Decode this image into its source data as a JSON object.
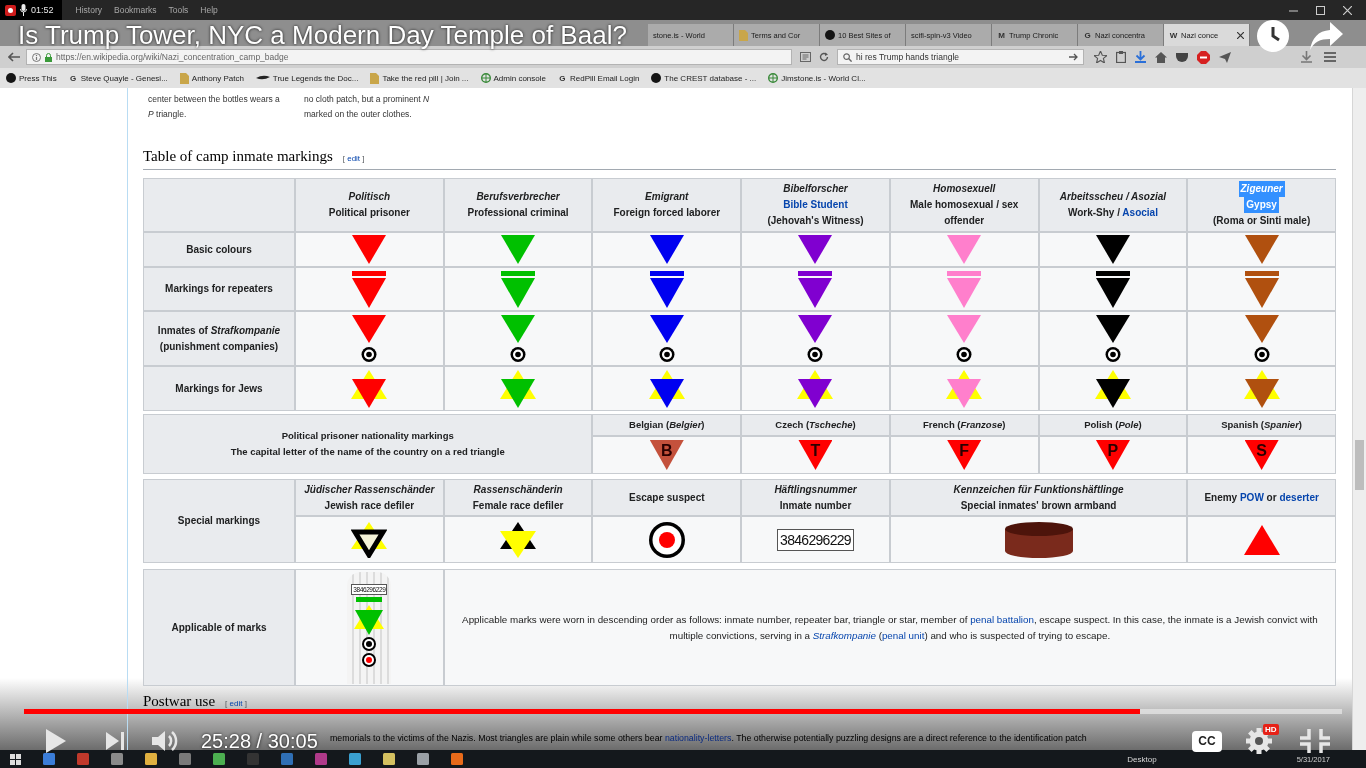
{
  "video": {
    "title": "Is Trump Tower, NYC a Modern Day Temple of Baal?"
  },
  "recorder": {
    "timer": "01:52"
  },
  "browser": {
    "menu": [
      "History",
      "Bookmarks",
      "Tools",
      "Help"
    ],
    "tabs": [
      {
        "title": "stone.is - World",
        "kind": "none",
        "selected": false
      },
      {
        "title": "Terms and Cor",
        "kind": "page",
        "selected": false
      },
      {
        "title": "10 Best Sites of",
        "kind": "disc",
        "selected": false
      },
      {
        "title": "scifi-spin-v3 Video",
        "kind": "none",
        "selected": false
      },
      {
        "title": "Trump Chronic",
        "kind": "letter",
        "favicon": "M",
        "selected": false
      },
      {
        "title": "Nazi concentra",
        "kind": "letter",
        "favicon": "G",
        "selected": false
      },
      {
        "title": "Nazi conce",
        "kind": "letter",
        "favicon": "W",
        "selected": true
      }
    ],
    "url": "https://en.wikipedia.org/wiki/Nazi_concentration_camp_badge",
    "search": {
      "value": "hi res Trump hands triangle"
    },
    "bookmarks": [
      {
        "label": "Press This",
        "kind": "disc"
      },
      {
        "label": "Steve Quayle - Genesi...",
        "kind": "letter",
        "favicon": "G"
      },
      {
        "label": "Anthony Patch",
        "kind": "page"
      },
      {
        "label": "True Legends the Doc...",
        "kind": "swoosh"
      },
      {
        "label": "Take the red pill | Join ...",
        "kind": "page"
      },
      {
        "label": "Admin console",
        "kind": "globe"
      },
      {
        "label": "RedPill Email Login",
        "kind": "letter",
        "favicon": "G"
      },
      {
        "label": "The CREST database - ...",
        "kind": "disc"
      },
      {
        "label": "Jimstone.is - World Cl...",
        "kind": "globe"
      }
    ]
  },
  "article": {
    "snippets": [
      {
        "lines": [
          "center between the bottles wears a",
          "*P* triangle."
        ]
      },
      {
        "lines": [
          "no cloth patch, but a prominent *N*",
          "marked on the outer clothes."
        ]
      }
    ],
    "heading": {
      "title": "Table of camp inmate markings",
      "edit": [
        {
          "kind": "plain",
          "text": "[ "
        },
        {
          "kind": "link",
          "text": "edit"
        },
        {
          "kind": "plain",
          "text": " ]"
        }
      ]
    },
    "table": {
      "categories": [
        {
          "color": "#ff0000",
          "lines": [
            {
              "kind": "german",
              "text": "Politisch",
              "selected": false
            },
            {
              "kind": "english",
              "text": "Political prisoner",
              "selected": false
            }
          ]
        },
        {
          "color": "#00c000",
          "lines": [
            {
              "kind": "german",
              "text": "Berufsverbrecher",
              "selected": false
            },
            {
              "kind": "english",
              "text": "Professional criminal",
              "selected": false
            }
          ]
        },
        {
          "color": "#0000f0",
          "lines": [
            {
              "kind": "german",
              "text": "Emigrant",
              "selected": false
            },
            {
              "kind": "english",
              "text": "Foreign forced laborer",
              "selected": false
            }
          ]
        },
        {
          "color": "#8000d0",
          "lines": [
            {
              "kind": "german",
              "text": "Bibelforscher",
              "selected": false
            },
            {
              "kind": "english",
              "parts": [
                {
                  "kind": "link",
                  "text": "Bible Student"
                }
              ],
              "selected": false
            },
            {
              "kind": "english",
              "text": "(Jehovah's Witness)",
              "selected": false
            }
          ]
        },
        {
          "color": "#ff7fcc",
          "lines": [
            {
              "kind": "german",
              "text": "Homosexuell",
              "selected": false
            },
            {
              "kind": "english",
              "text": "Male homosexual / sex offender",
              "selected": false
            }
          ]
        },
        {
          "color": "#000000",
          "lines": [
            {
              "kind": "german",
              "text": "Arbeitsscheu / Asozial",
              "selected": false
            },
            {
              "kind": "english",
              "parts": [
                {
                  "kind": "plain",
                  "text": "Work-Shy / "
                },
                {
                  "kind": "link",
                  "text": "Asocial"
                }
              ],
              "selected": false
            }
          ]
        },
        {
          "color": "#b0500f",
          "lines": [
            {
              "kind": "german",
              "text": "Zigeuner",
              "selected": true
            },
            {
              "kind": "english",
              "text": "Gypsy",
              "selected": true
            },
            {
              "kind": "english",
              "text": "(Roma or Sinti male)",
              "selected": false
            }
          ]
        }
      ],
      "rows": [
        {
          "label": "Basic colours",
          "kind": "basic"
        },
        {
          "label": "Markings for repeaters",
          "kind": "repeater"
        },
        {
          "label": "Inmates of *Strafkompanie* (punishment companies)",
          "kind": "punishment"
        },
        {
          "label": "Markings for Jews",
          "kind": "jewish"
        }
      ],
      "nationality": {
        "lines": [
          "Political prisoner nationality markings",
          "The capital letter of the name of the country on a red triangle"
        ],
        "items": [
          {
            "label": "Belgian (*Belgier*)",
            "letter": "B",
            "color": "#c4513c"
          },
          {
            "label": "Czech (*Tscheche*)",
            "letter": "T",
            "color": "#ff0000"
          },
          {
            "label": "French (*Franzose*)",
            "letter": "F",
            "color": "#ff0000"
          },
          {
            "label": "Polish (*Pole*)",
            "letter": "P",
            "color": "#ff0000"
          },
          {
            "label": "Spanish (*Spanier*)",
            "letter": "S",
            "color": "#ff0000"
          }
        ]
      },
      "special": {
        "label": "Special markings",
        "items": [
          {
            "kind": "hollow-star",
            "lines": [
              {
                "kind": "german",
                "text": "Jüdischer Rassenschänder"
              },
              {
                "kind": "english",
                "text": "Jewish race defiler"
              }
            ]
          },
          {
            "kind": "star",
            "lines": [
              {
                "kind": "german",
                "text": "Rassenschänderin"
              },
              {
                "kind": "english",
                "text": "Female race defiler"
              }
            ]
          },
          {
            "kind": "target",
            "lines": [
              {
                "kind": "english",
                "text": "Escape suspect"
              }
            ]
          },
          {
            "kind": "number",
            "number": "3846296229",
            "lines": [
              {
                "kind": "german",
                "text": "Häftlingsnummer"
              },
              {
                "kind": "english",
                "text": "Inmate number"
              }
            ]
          },
          {
            "kind": "armband",
            "lines": [
              {
                "kind": "german",
                "text": "Kennzeichen für Funktionshäftlinge"
              },
              {
                "kind": "english",
                "text": "Special inmates' brown armband"
              }
            ]
          },
          {
            "kind": "triangle",
            "lines": [
              {
                "kind": "english",
                "parts": [
                  {
                    "kind": "plain",
                    "text": "Enemy "
                  },
                  {
                    "kind": "link",
                    "text": "POW"
                  },
                  {
                    "kind": "plain",
                    "text": " or "
                  },
                  {
                    "kind": "link",
                    "text": "deserter"
                  }
                ]
              }
            ]
          }
        ]
      },
      "applicable": {
        "label": "Applicable of marks",
        "number": "3846296229",
        "text": [
          {
            "kind": "plain",
            "text": "Applicable marks were worn in descending order as follows: inmate number, repeater bar, triangle or star, member of "
          },
          {
            "kind": "link",
            "text": "penal battalion"
          },
          {
            "kind": "plain",
            "text": ", escape suspect. In this case, the inmate is a Jewish convict with multiple convictions, serving in a "
          },
          {
            "kind": "link",
            "text": "*Strafkompanie*"
          },
          {
            "kind": "plain",
            "text": " ("
          },
          {
            "kind": "link",
            "text": "penal unit"
          },
          {
            "kind": "plain",
            "text": ") and who is suspected of trying to escape."
          }
        ]
      }
    },
    "next_heading": {
      "title": "Postwar use",
      "edit": [
        {
          "kind": "plain",
          "text": "[ "
        },
        {
          "kind": "link",
          "text": "edit"
        },
        {
          "kind": "plain",
          "text": " ]"
        }
      ]
    },
    "next_text": [
      {
        "kind": "plain",
        "text": "memorials to the victims of the Nazis. Most triangles are plain while some others bear "
      },
      {
        "kind": "link",
        "text": "nationality-letters"
      },
      {
        "kind": "plain",
        "text": ". The otherwise potentially puzzling designs are a direct reference to the identification patch"
      }
    ]
  },
  "taskbar": {
    "desktop_label": "Desktop",
    "date": "5/31/2017"
  },
  "player": {
    "level": 0.847,
    "time": "25:28 / 30:05",
    "captions_label": "CC",
    "quality_badge": "HD"
  }
}
